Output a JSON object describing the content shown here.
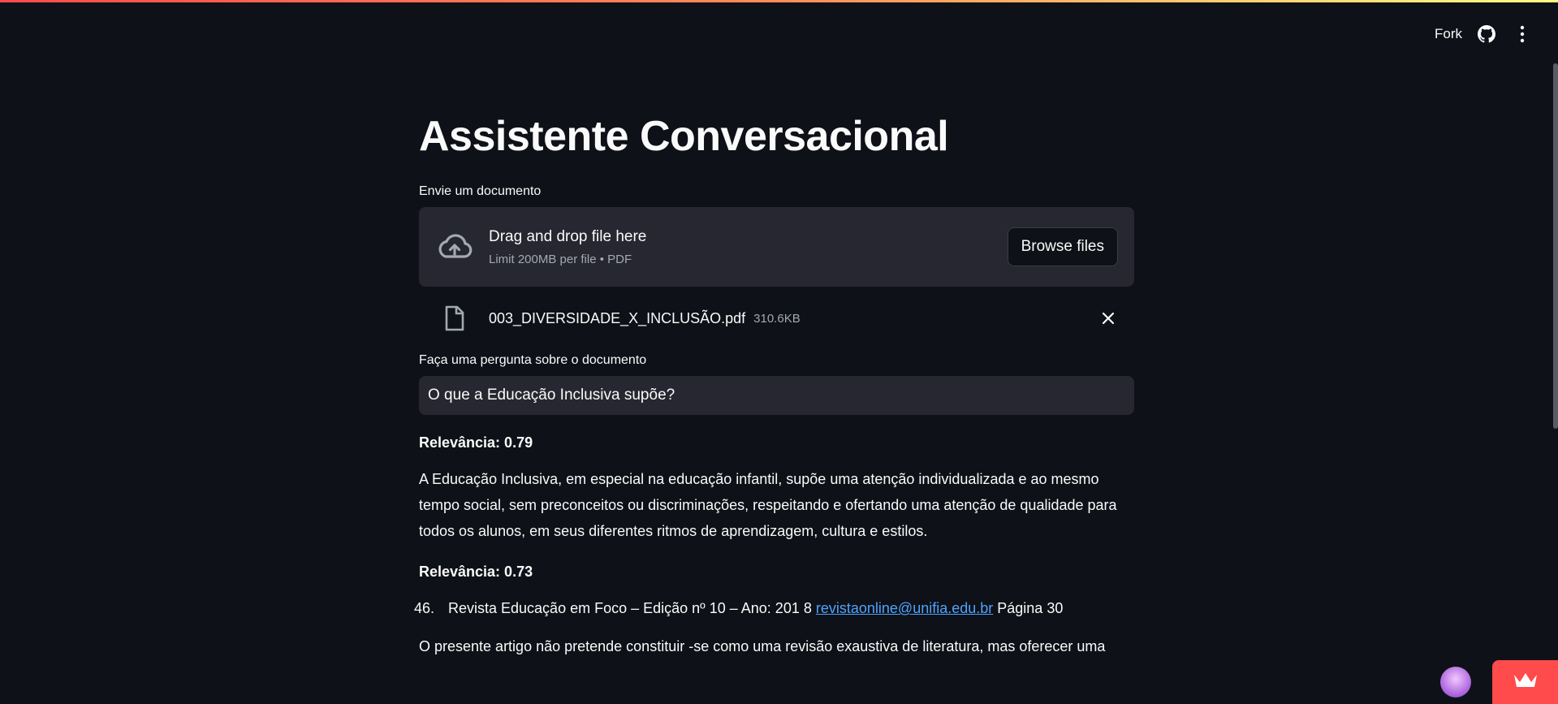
{
  "toolbar": {
    "fork_label": "Fork"
  },
  "page": {
    "title": "Assistente Conversacional"
  },
  "uploader": {
    "label": "Envie um documento",
    "drag_text": "Drag and drop file here",
    "limit_text": "Limit 200MB per file • PDF",
    "browse_label": "Browse files"
  },
  "file": {
    "name": "003_DIVERSIDADE_X_INCLUSÃO.pdf",
    "size": "310.6KB"
  },
  "question": {
    "label": "Faça uma pergunta sobre o documento",
    "value": "O que a Educação Inclusiva supõe?"
  },
  "results": [
    {
      "relevance": "Relevância: 0.79",
      "text": "A Educação Inclusiva, em especial na educação infantil, supõe uma atenção individualizada e ao mesmo tempo social, sem preconceitos ou discriminações, respeitando e ofertando uma atenção de qualidade para todos os alunos, em seus diferentes ritmos de aprendizagem, cultura e estilos."
    },
    {
      "relevance": "Relevância: 0.73",
      "list_number": "46.",
      "list_text_before": "Revista Educação em Foco – Edição nº 10 – Ano: 201 8 ",
      "list_link": "revistaonline@unifia.edu.br",
      "list_text_after": " Página 30",
      "text": "O presente artigo não pretende constituir -se como uma revisão exaustiva de literatura, mas oferecer uma"
    }
  ],
  "colors": {
    "background": "#0e1117",
    "surface": "#262730",
    "accent": "#ff4b4b",
    "link": "#4fa3ff"
  }
}
